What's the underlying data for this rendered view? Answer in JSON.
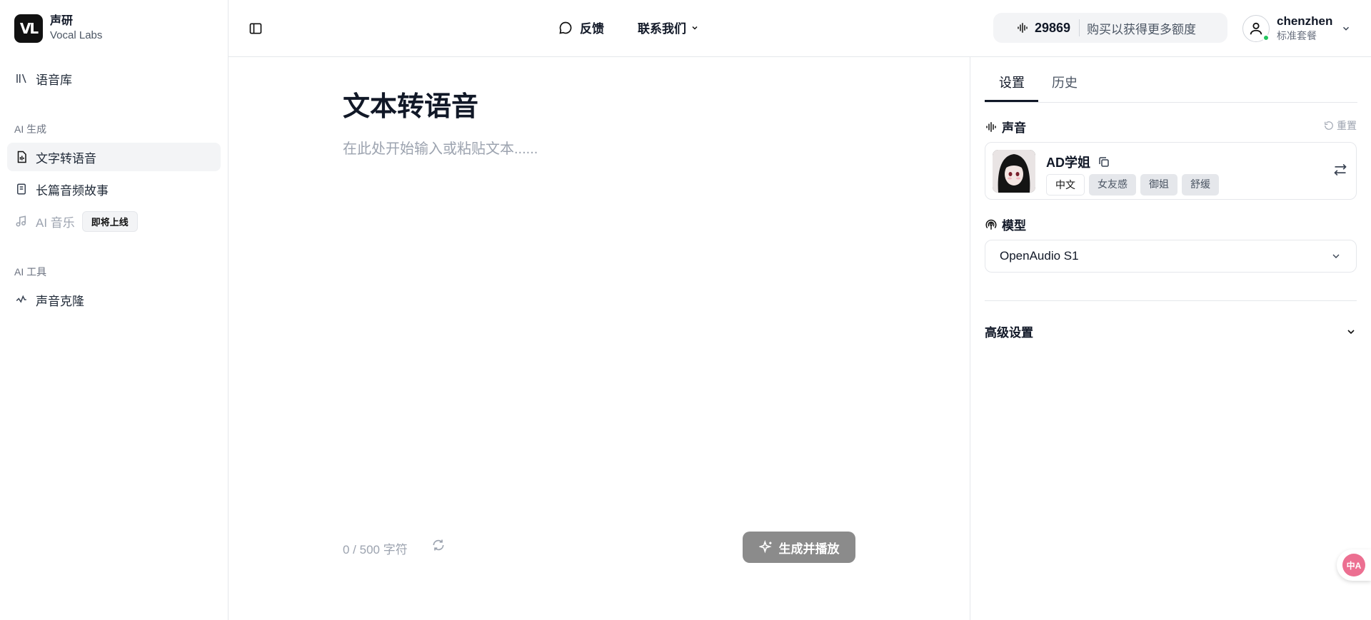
{
  "brand": {
    "logo": "VL",
    "name": "声研",
    "sub": "Vocal Labs"
  },
  "sidebar": {
    "library": "语音库",
    "section_ai_gen": "AI 生成",
    "items": [
      {
        "label": "文字转语音"
      },
      {
        "label": "长篇音频故事"
      },
      {
        "label": "AI 音乐",
        "badge": "即将上线"
      }
    ],
    "section_ai_tools": "AI 工具",
    "voice_clone": "声音克隆"
  },
  "header": {
    "feedback": "反馈",
    "contact": "联系我们",
    "credits": "29869",
    "buy": "购买以获得更多额度",
    "user_name": "chenzhen",
    "user_plan": "标准套餐"
  },
  "main": {
    "title": "文本转语音",
    "placeholder": "在此处开始输入或粘贴文本......",
    "char_count": "0 / 500 字符",
    "generate": "生成并播放"
  },
  "panel": {
    "tabs": [
      "设置",
      "历史"
    ],
    "voice_title": "声音",
    "reset": "重置",
    "voice": {
      "name": "AD学姐",
      "tags": [
        "中文",
        "女友感",
        "御姐",
        "舒缓"
      ]
    },
    "model_title": "模型",
    "model_value": "OpenAudio S1",
    "advanced": "高级设置"
  },
  "translate_fab": "中A",
  "colors": {
    "accent": "#111827",
    "online": "#22c55e",
    "button_disabled": "#8b8b8b"
  }
}
